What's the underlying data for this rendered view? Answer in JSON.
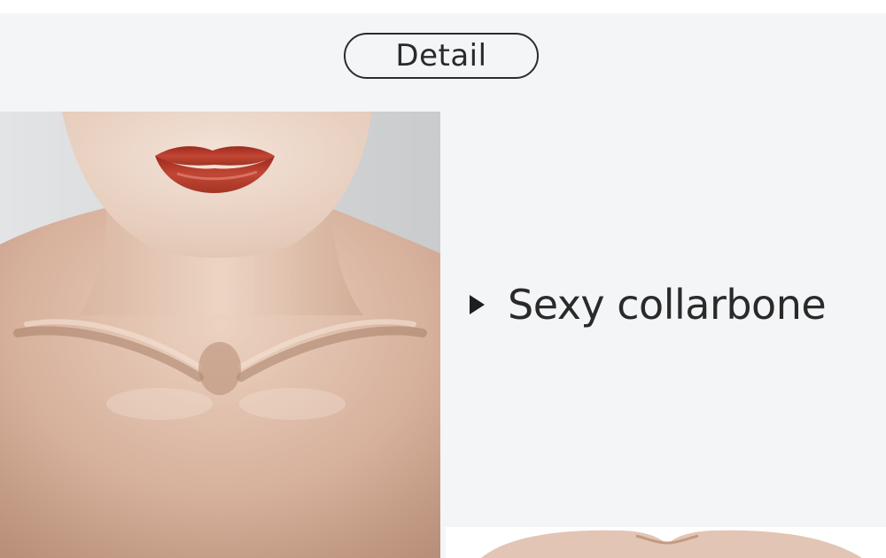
{
  "section": {
    "title_badge": "Detail"
  },
  "feature": {
    "label": "Sexy collarbone",
    "bullet_icon": "triangle-right-icon"
  },
  "colors": {
    "panel_background": "#f4f5f7",
    "text": "#2a2a2a",
    "lip": "#b5392a",
    "skin": "#d9b8a2"
  }
}
